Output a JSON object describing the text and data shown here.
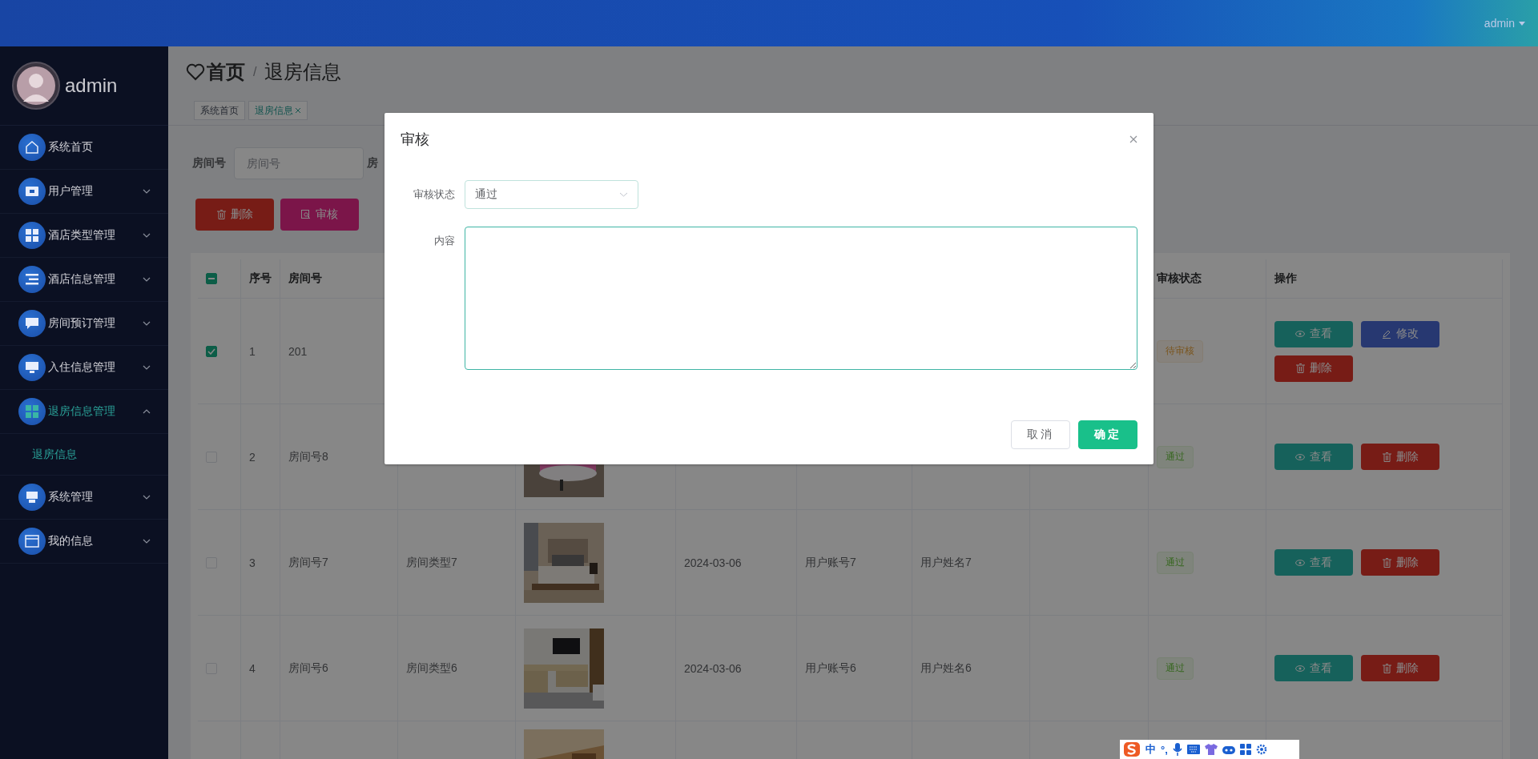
{
  "topbar": {
    "user": "admin"
  },
  "sidebar": {
    "user": "admin",
    "items": [
      {
        "label": "系统首页",
        "kind": "link",
        "selected": false
      },
      {
        "label": "用户管理",
        "kind": "group",
        "expanded": false,
        "selected": false
      },
      {
        "label": "酒店类型管理",
        "kind": "group",
        "expanded": false,
        "selected": false
      },
      {
        "label": "酒店信息管理",
        "kind": "group",
        "expanded": false,
        "selected": false
      },
      {
        "label": "房间预订管理",
        "kind": "group",
        "expanded": false,
        "selected": false
      },
      {
        "label": "入住信息管理",
        "kind": "group",
        "expanded": false,
        "selected": false
      },
      {
        "label": "退房信息管理",
        "kind": "group",
        "expanded": true,
        "selected": true,
        "children": [
          {
            "label": "退房信息",
            "selected": true
          }
        ]
      },
      {
        "label": "系统管理",
        "kind": "group",
        "expanded": false,
        "selected": false
      },
      {
        "label": "我的信息",
        "kind": "group",
        "expanded": false,
        "selected": false
      }
    ]
  },
  "breadcrumb": {
    "home": "首页",
    "separator": "/",
    "current": "退房信息"
  },
  "tags": [
    {
      "label": "系统首页",
      "selected": false,
      "closable": false
    },
    {
      "label": "退房信息",
      "selected": true,
      "closable": true
    }
  ],
  "search": {
    "label": "房间号",
    "placeholder": "房间号",
    "next_label": "房"
  },
  "toolbar": [
    {
      "label": "删除",
      "kind": "delete"
    },
    {
      "label": "审核",
      "kind": "review"
    }
  ],
  "table": {
    "header_checkbox_indeterminate": true,
    "headers": {
      "index": "序号",
      "room": "房间号",
      "status": "审核状态",
      "actions": "操作"
    },
    "rows": [
      {
        "selected": true,
        "index": "1",
        "room": "201",
        "status": {
          "label": "待审核",
          "kind": "pending"
        },
        "actions": [
          {
            "label": "查看",
            "kind": "view"
          },
          {
            "label": "修改",
            "kind": "edit"
          },
          {
            "label": "删除",
            "kind": "delete"
          }
        ]
      },
      {
        "selected": false,
        "index": "2",
        "room": "房间号8",
        "image": {
          "kind": "picture"
        },
        "status": {
          "label": "通过",
          "kind": "passed"
        },
        "actions": [
          {
            "label": "查看",
            "kind": "view"
          },
          {
            "label": "删除",
            "kind": "delete"
          }
        ]
      },
      {
        "selected": false,
        "index": "3",
        "room": "房间号7",
        "room_type": "房间类型7",
        "image": {
          "kind": "picture"
        },
        "date": "2024-03-06",
        "account": "用户账号7",
        "name": "用户姓名7",
        "status": {
          "label": "通过",
          "kind": "passed"
        },
        "actions": [
          {
            "label": "查看",
            "kind": "view"
          },
          {
            "label": "删除",
            "kind": "delete"
          }
        ]
      },
      {
        "selected": false,
        "index": "4",
        "room": "房间号6",
        "room_type": "房间类型6",
        "image": {
          "kind": "picture"
        },
        "date": "2024-03-06",
        "account": "用户账号6",
        "name": "用户姓名6",
        "status": {
          "label": "通过",
          "kind": "passed"
        },
        "actions": [
          {
            "label": "查看",
            "kind": "view"
          },
          {
            "label": "删除",
            "kind": "delete"
          }
        ]
      },
      {
        "image": {
          "kind": "picture"
        }
      }
    ]
  },
  "modal": {
    "title": "审核",
    "fields": [
      {
        "label": "审核状态",
        "kind": "select",
        "value": "通过"
      },
      {
        "label": "内容",
        "kind": "textarea",
        "focused": true
      }
    ],
    "buttons": [
      {
        "label": "取消",
        "kind": "default"
      },
      {
        "label": "确定",
        "kind": "primary"
      }
    ]
  },
  "ime": {
    "mode": "中",
    "punct": "°,"
  }
}
